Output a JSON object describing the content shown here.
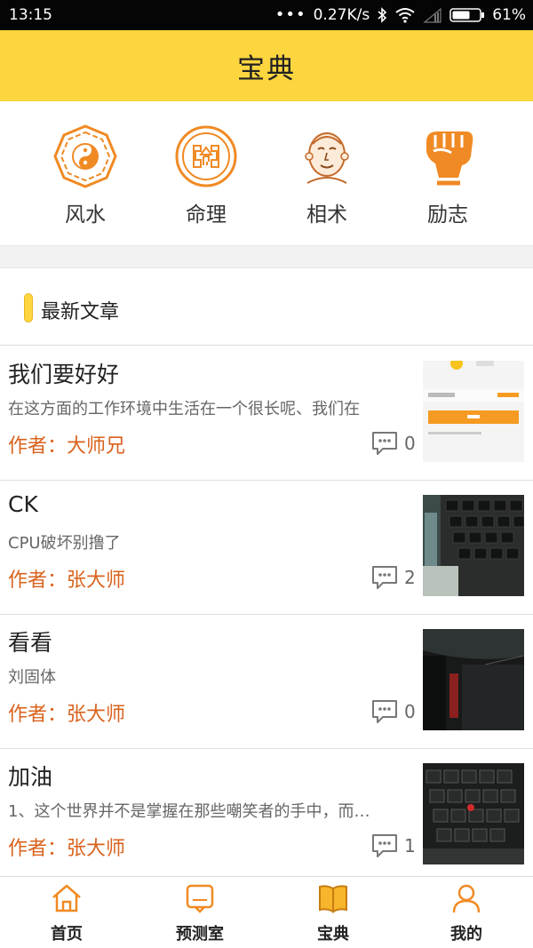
{
  "status_bar": {
    "time": "13:15",
    "network_speed": "0.27K/s",
    "battery": "61%"
  },
  "header": {
    "title": "宝典"
  },
  "categories": [
    {
      "label": "风水",
      "icon": "bagua-icon"
    },
    {
      "label": "命理",
      "icon": "fate-seal-icon"
    },
    {
      "label": "相术",
      "icon": "face-reading-icon"
    },
    {
      "label": "励志",
      "icon": "fist-icon"
    }
  ],
  "section": {
    "title": "最新文章"
  },
  "articles": [
    {
      "title": "我们要好好",
      "description": "在这方面的工作环境中生活在一个很长呢、我们在",
      "author": "作者：大师兄",
      "comments": "0",
      "thumb": "app-screenshot"
    },
    {
      "title": "CK",
      "description": "CPU破坏别撸了",
      "author": "作者：张大师",
      "comments": "2",
      "thumb": "keyboard-photo"
    },
    {
      "title": "看看",
      "description": "刘固体",
      "author": "作者：张大师",
      "comments": "0",
      "thumb": "laptop-edge-photo"
    },
    {
      "title": "加油",
      "description": "1、这个世界并不是掌握在那些嘲笑者的手中，而…",
      "author": "作者：张大师",
      "comments": "1",
      "thumb": "keyboard-trackpoint-photo"
    }
  ],
  "tabs": [
    {
      "label": "首页",
      "icon": "home-icon",
      "active": false
    },
    {
      "label": "预测室",
      "icon": "chat-icon",
      "active": false
    },
    {
      "label": "宝典",
      "icon": "book-icon",
      "active": true
    },
    {
      "label": "我的",
      "icon": "user-icon",
      "active": false
    }
  ],
  "colors": {
    "accent": "#fcd53f",
    "orange": "#f08a24",
    "author": "#d9621d"
  }
}
